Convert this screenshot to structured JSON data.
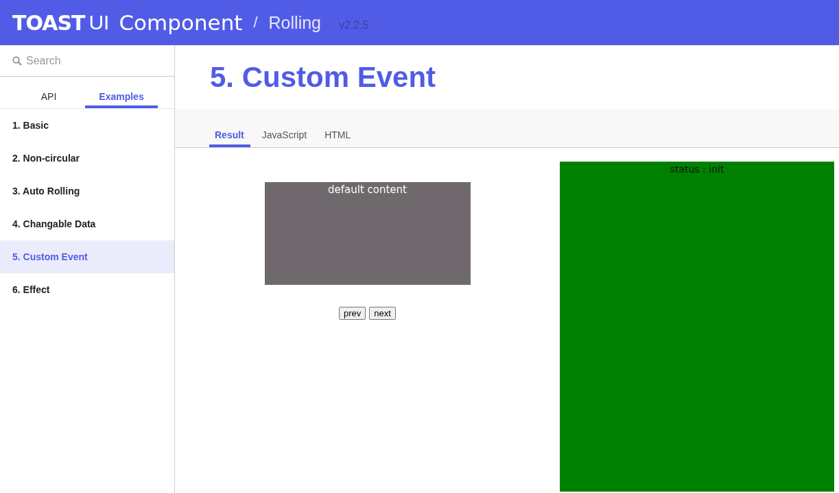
{
  "header": {
    "logo_mark": "TOAST",
    "logo_ui": "UI",
    "logo_text": "Component",
    "separator": "/",
    "product": "Rolling",
    "version": "v2.2.5"
  },
  "search": {
    "placeholder": "Search"
  },
  "sidebar_tabs": [
    {
      "label": "API",
      "selected": false
    },
    {
      "label": "Examples",
      "selected": true
    }
  ],
  "sidebar": {
    "items": [
      {
        "label": "1. Basic",
        "selected": false
      },
      {
        "label": "2. Non-circular",
        "selected": false
      },
      {
        "label": "3. Auto Rolling",
        "selected": false
      },
      {
        "label": "4. Changable Data",
        "selected": false
      },
      {
        "label": "5. Custom Event",
        "selected": true
      },
      {
        "label": "6. Effect",
        "selected": false
      }
    ]
  },
  "page_title": "5. Custom Event",
  "code_tabs": [
    {
      "label": "Result",
      "selected": true
    },
    {
      "label": "JavaScript",
      "selected": false
    },
    {
      "label": "HTML",
      "selected": false
    }
  ],
  "example": {
    "rolling_panel": "default content",
    "buttons": [
      "prev",
      "next"
    ],
    "status": "status : init"
  }
}
